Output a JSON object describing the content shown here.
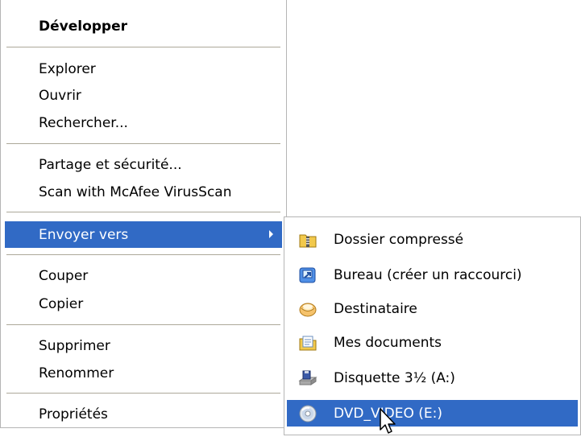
{
  "context_menu": {
    "items": [
      {
        "label": "Développer"
      },
      {
        "label": "Explorer"
      },
      {
        "label": "Ouvrir"
      },
      {
        "label": "Rechercher..."
      },
      {
        "label": "Partage et sécurité..."
      },
      {
        "label": "Scan with McAfee VirusScan"
      },
      {
        "label": "Envoyer vers"
      },
      {
        "label": "Couper"
      },
      {
        "label": "Copier"
      },
      {
        "label": "Supprimer"
      },
      {
        "label": "Renommer"
      },
      {
        "label": "Propriétés"
      }
    ]
  },
  "send_to_menu": {
    "items": [
      {
        "label": "Dossier compressé",
        "icon": "zip-folder-icon"
      },
      {
        "label": "Bureau (créer un raccourci)",
        "icon": "desktop-shortcut-icon"
      },
      {
        "label": "Destinataire",
        "icon": "mail-recipient-icon"
      },
      {
        "label": "Mes documents",
        "icon": "my-documents-icon"
      },
      {
        "label": "Disquette 3½ (A:)",
        "icon": "floppy-drive-icon"
      },
      {
        "label": "DVD_VIDEO (E:)",
        "icon": "dvd-drive-icon"
      }
    ]
  },
  "colors": {
    "highlight": "#316ac5",
    "separator": "#aca899",
    "border": "#b5b5b5"
  }
}
